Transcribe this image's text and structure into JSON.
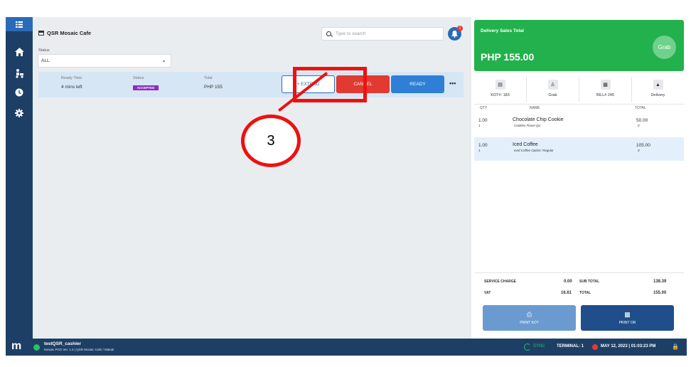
{
  "store": {
    "name": "QSR Mosaic Cafe"
  },
  "search": {
    "placeholder": "Type to search"
  },
  "notifications": {
    "count": "1"
  },
  "filter": {
    "label": "Status",
    "value": "ALL"
  },
  "order": {
    "ready_time_label": "Ready Time",
    "ready_time_value": "4 mins left",
    "status_label": "Status",
    "status_value": "ACCEPTED",
    "total_label": "Total",
    "total_value": "PHP 155",
    "extend_label": "+ EXTEND",
    "cancel_label": "CANCEL",
    "ready_label": "READY",
    "more_label": "•••"
  },
  "annotation": {
    "step_number": "3"
  },
  "delivery": {
    "title": "Delivery Sales Total",
    "amount": "PHP 155.00",
    "logo_text": "Grab"
  },
  "order_info": [
    {
      "icon": "receipt-icon",
      "label": "KOT#: 183"
    },
    {
      "icon": "person-icon",
      "label": "Grab"
    },
    {
      "icon": "document-icon",
      "label": "BILL# 245"
    },
    {
      "icon": "delivery-icon",
      "label": "Delivery"
    }
  ],
  "table": {
    "headers": [
      "QTY",
      "NAME",
      "TOTAL"
    ],
    "items": [
      {
        "qty": "1.00",
        "qty_sub": "1",
        "name": "Chocolate Chip Cookie",
        "modifier": "Cookies Flavor (pc",
        "total": "50.00",
        "total_sub": "0"
      },
      {
        "qty": "1.00",
        "qty_sub": "1",
        "name": "Iced Coffee",
        "modifier": "Iced Coffee Option: Regular",
        "total": "105.00",
        "total_sub": "0"
      }
    ]
  },
  "summary": {
    "service_charge_label": "SERVICE CHARGE",
    "service_charge_value": "0.00",
    "vat_label": "VAT",
    "vat_value": "16.61",
    "subtotal_label": "SUB TOTAL",
    "subtotal_value": "138.39",
    "total_label": "TOTAL",
    "total_value": "155.00"
  },
  "actions": {
    "print_kot": "PRINT KOT",
    "print_or": "PRINT OR"
  },
  "statusbar": {
    "user": "testQSR_cashier",
    "version": "Mosaic POS Ver. 1.5 | QSR Mosaic Cafe / Makati",
    "sync": "SYNC",
    "terminal": "TERMINAL: 1",
    "datetime": "MAY 12, 2023 | 01:03:23 PM"
  },
  "colors": {
    "sidebar": "#1d3f66",
    "accent": "#2a6bb8",
    "grab_green": "#22b14c",
    "cancel_red": "#e03a31",
    "highlight_red": "#ee1111"
  }
}
